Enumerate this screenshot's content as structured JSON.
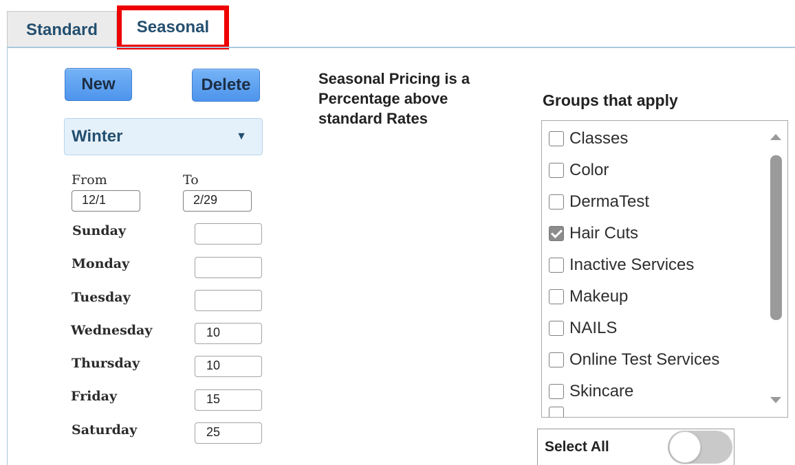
{
  "tabs": {
    "standard": "Standard",
    "seasonal": "Seasonal",
    "active": "Seasonal",
    "highlight_color": "#ee0000"
  },
  "buttons": {
    "new": "New",
    "delete": "Delete"
  },
  "season_select": {
    "selected": "Winter",
    "caret_icon": "caret-down-icon"
  },
  "date_range": {
    "from_label": "From",
    "from_value": "12/1",
    "to_label": "To",
    "to_value": "2/29"
  },
  "days": [
    {
      "label": "Sunday",
      "value": ""
    },
    {
      "label": "Monday",
      "value": ""
    },
    {
      "label": "Tuesday",
      "value": ""
    },
    {
      "label": "Wednesday",
      "value": "10"
    },
    {
      "label": "Thursday",
      "value": "10"
    },
    {
      "label": "Friday",
      "value": "15"
    },
    {
      "label": "Saturday",
      "value": "25"
    }
  ],
  "info_text": {
    "line1": "Seasonal Pricing is a",
    "line2": "Percentage above",
    "line3": "standard Rates"
  },
  "groups": {
    "title": "Groups that apply",
    "items": [
      {
        "label": "Classes",
        "checked": false
      },
      {
        "label": "Color",
        "checked": false
      },
      {
        "label": "DermaTest",
        "checked": false
      },
      {
        "label": "Hair Cuts",
        "checked": true
      },
      {
        "label": "Inactive Services",
        "checked": false
      },
      {
        "label": "Makeup",
        "checked": false
      },
      {
        "label": "NAILS",
        "checked": false
      },
      {
        "label": "Online Test Services",
        "checked": false
      },
      {
        "label": "Skincare",
        "checked": false
      }
    ]
  },
  "select_all": {
    "label": "Select All",
    "enabled": false
  },
  "colors": {
    "button_blue": "#4d94ec",
    "tab_text": "#244f6f",
    "select_bg": "#e5f1fa"
  }
}
